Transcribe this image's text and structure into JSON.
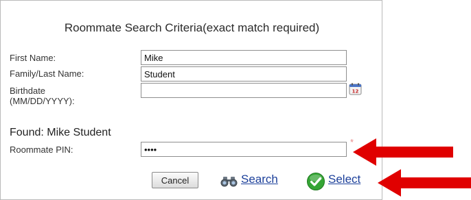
{
  "form": {
    "title": "Roommate Search Criteria(exact match required)",
    "first_name_label": "First Name:",
    "first_name_value": "Mike",
    "last_name_label": "Family/Last Name:",
    "last_name_value": "Student",
    "birthdate_label_line1": "Birthdate",
    "birthdate_label_line2": "(MM/DD/YYYY):",
    "birthdate_value": "",
    "found_text": "Found: Mike Student",
    "pin_label": "Roommate PIN:",
    "pin_value": "••••",
    "required_marker": "*"
  },
  "actions": {
    "cancel_label": "Cancel",
    "search_label": "Search",
    "select_label": "Select"
  },
  "icons": {
    "calendar": "calendar-icon",
    "binoculars": "binoculars-icon",
    "check": "check-circle-icon",
    "arrow": "red-arrow"
  },
  "colors": {
    "link": "#1b3f9a",
    "arrow": "#e00000",
    "check": "#2e9c2e"
  }
}
